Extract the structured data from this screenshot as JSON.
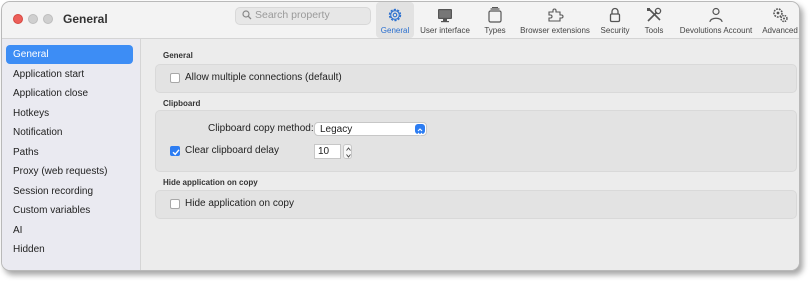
{
  "window": {
    "title": "General"
  },
  "search": {
    "placeholder": "Search property"
  },
  "toolbar": {
    "tabs": [
      {
        "label": "General",
        "icon": "gear-icon",
        "active": true
      },
      {
        "label": "User interface",
        "icon": "monitor-icon"
      },
      {
        "label": "Types",
        "icon": "types-icon"
      },
      {
        "label": "Browser extensions",
        "icon": "puzzle-icon"
      },
      {
        "label": "Security",
        "icon": "lock-icon"
      },
      {
        "label": "Tools",
        "icon": "tools-icon"
      },
      {
        "label": "Devolutions Account",
        "icon": "person-icon"
      },
      {
        "label": "Advanced",
        "icon": "gears-icon"
      }
    ]
  },
  "sidebar": {
    "items": [
      {
        "label": "General",
        "active": true
      },
      {
        "label": "Application start"
      },
      {
        "label": "Application close"
      },
      {
        "label": "Hotkeys"
      },
      {
        "label": "Notification"
      },
      {
        "label": "Paths"
      },
      {
        "label": "Proxy (web requests)"
      },
      {
        "label": "Session recording"
      },
      {
        "label": "Custom variables"
      },
      {
        "label": "AI"
      },
      {
        "label": "Hidden"
      }
    ]
  },
  "sections": {
    "general": {
      "title": "General",
      "allow_multiple": {
        "label": "Allow multiple connections (default)",
        "checked": false
      }
    },
    "clipboard": {
      "title": "Clipboard",
      "copy_method_label": "Clipboard copy method:",
      "copy_method_value": "Legacy",
      "clear_delay": {
        "label": "Clear clipboard delay",
        "checked": true,
        "value": "10"
      }
    },
    "hide": {
      "title": "Hide application on copy",
      "hide_app": {
        "label": "Hide application on copy",
        "checked": false
      }
    }
  },
  "colors": {
    "accent": "#2d7df2",
    "sidebar_active": "#3d8df5",
    "close_button": "#ec5f5a"
  }
}
